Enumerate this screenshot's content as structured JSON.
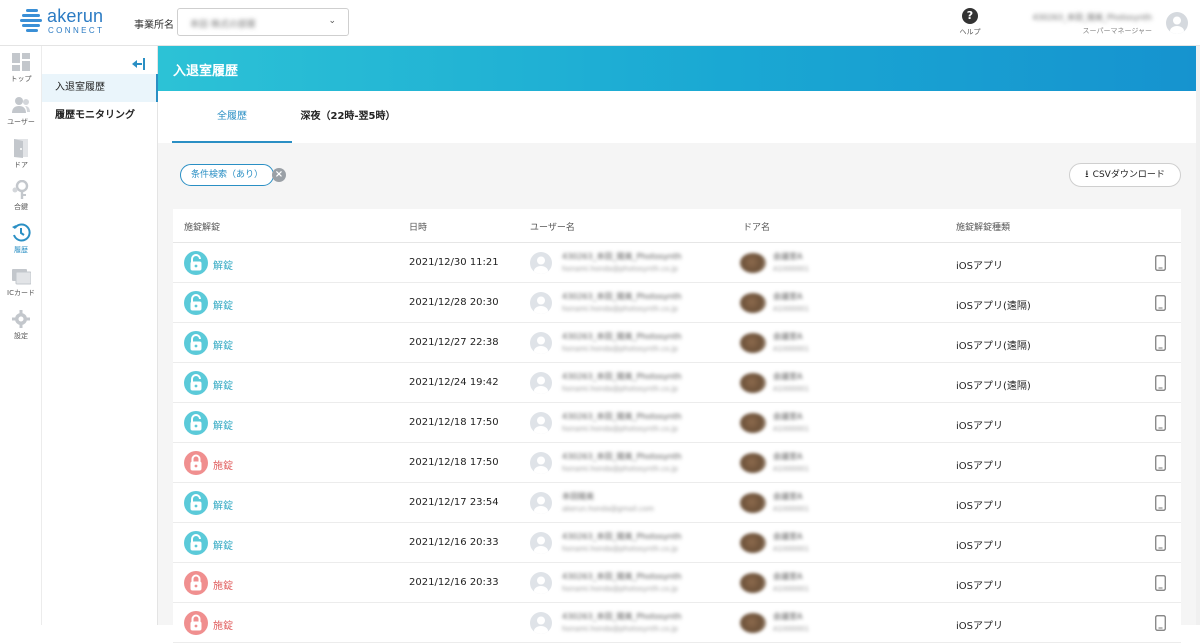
{
  "header": {
    "logo_name": "akerun",
    "logo_sub": "CONNECT",
    "office_label": "事業所名",
    "office_value": "本田 株式の部屋",
    "help_label": "ヘルプ",
    "user_name": "430263_本田_陽美_Photosynth",
    "user_role": "スーパーマネージャー",
    "icons": [
      "help-icon",
      "avatar-icon",
      "chevron-down-icon"
    ]
  },
  "rail": {
    "items": [
      {
        "label": "トップ",
        "icon": "dashboard-icon"
      },
      {
        "label": "ユーザー",
        "icon": "users-icon"
      },
      {
        "label": "ドア",
        "icon": "door-icon"
      },
      {
        "label": "合鍵",
        "icon": "key-icon"
      },
      {
        "label": "履歴",
        "icon": "history-icon"
      },
      {
        "label": "ICカード",
        "icon": "card-icon"
      },
      {
        "label": "設定",
        "icon": "gear-icon"
      }
    ]
  },
  "submenu": {
    "items": [
      {
        "label": "入退室履歴"
      },
      {
        "label": "履歴モニタリング"
      }
    ]
  },
  "page": {
    "title": "入退室履歴",
    "tabs": [
      {
        "label": "全履歴"
      },
      {
        "label": "深夜（22時-翌5時）"
      }
    ],
    "filter_chip": "条件検索（あり）",
    "csv_button": "CSVダウンロード"
  },
  "table": {
    "headers": [
      "施錠解錠",
      "日時",
      "ユーザー名",
      "ドア名",
      "施錠解錠種類"
    ],
    "rows": [
      {
        "action": "解錠",
        "state": "open",
        "date": "2021/12/30 11:21",
        "user": "430263_本田_陽美_Photosynth",
        "email": "honami.honda@photosynth.co.jp",
        "door": "会議室A",
        "door_sub": "A1000001",
        "method": "iOSアプリ"
      },
      {
        "action": "解錠",
        "state": "open",
        "date": "2021/12/28 20:30",
        "user": "430263_本田_陽美_Photosynth",
        "email": "honami.honda@photosynth.co.jp",
        "door": "会議室A",
        "door_sub": "A1000001",
        "method": "iOSアプリ(遠隔)"
      },
      {
        "action": "解錠",
        "state": "open",
        "date": "2021/12/27 22:38",
        "user": "430263_本田_陽美_Photosynth",
        "email": "honami.honda@photosynth.co.jp",
        "door": "会議室A",
        "door_sub": "A1000001",
        "method": "iOSアプリ(遠隔)"
      },
      {
        "action": "解錠",
        "state": "open",
        "date": "2021/12/24 19:42",
        "user": "430263_本田_陽美_Photosynth",
        "email": "honami.honda@photosynth.co.jp",
        "door": "会議室A",
        "door_sub": "A1000001",
        "method": "iOSアプリ(遠隔)"
      },
      {
        "action": "解錠",
        "state": "open",
        "date": "2021/12/18 17:50",
        "user": "430263_本田_陽美_Photosynth",
        "email": "honami.honda@photosynth.co.jp",
        "door": "会議室A",
        "door_sub": "A1000001",
        "method": "iOSアプリ"
      },
      {
        "action": "施錠",
        "state": "closed",
        "date": "2021/12/18 17:50",
        "user": "430263_本田_陽美_Photosynth",
        "email": "honami.honda@photosynth.co.jp",
        "door": "会議室A",
        "door_sub": "A1000001",
        "method": "iOSアプリ"
      },
      {
        "action": "解錠",
        "state": "open",
        "date": "2021/12/17 23:54",
        "user": "本田陽美",
        "email": "akerun.honda@gmail.com",
        "door": "会議室A",
        "door_sub": "A1000001",
        "method": "iOSアプリ"
      },
      {
        "action": "解錠",
        "state": "open",
        "date": "2021/12/16 20:33",
        "user": "430263_本田_陽美_Photosynth",
        "email": "honami.honda@photosynth.co.jp",
        "door": "会議室A",
        "door_sub": "A1000001",
        "method": "iOSアプリ"
      },
      {
        "action": "施錠",
        "state": "closed",
        "date": "2021/12/16 20:33",
        "user": "430263_本田_陽美_Photosynth",
        "email": "honami.honda@photosynth.co.jp",
        "door": "会議室A",
        "door_sub": "A1000001",
        "method": "iOSアプリ"
      },
      {
        "action": "施錠",
        "state": "closed",
        "date": "",
        "user": "430263_本田_陽美_Photosynth",
        "email": "honami.honda@photosynth.co.jp",
        "door": "会議室A",
        "door_sub": "A1000001",
        "method": "iOSアプリ"
      }
    ]
  },
  "colors": {
    "accent": "#2a8fc4",
    "header_gradient_start": "#2cc2d6",
    "header_gradient_end": "#1693cf",
    "unlock": "#5bcad9",
    "lock": "#f08f8f"
  }
}
